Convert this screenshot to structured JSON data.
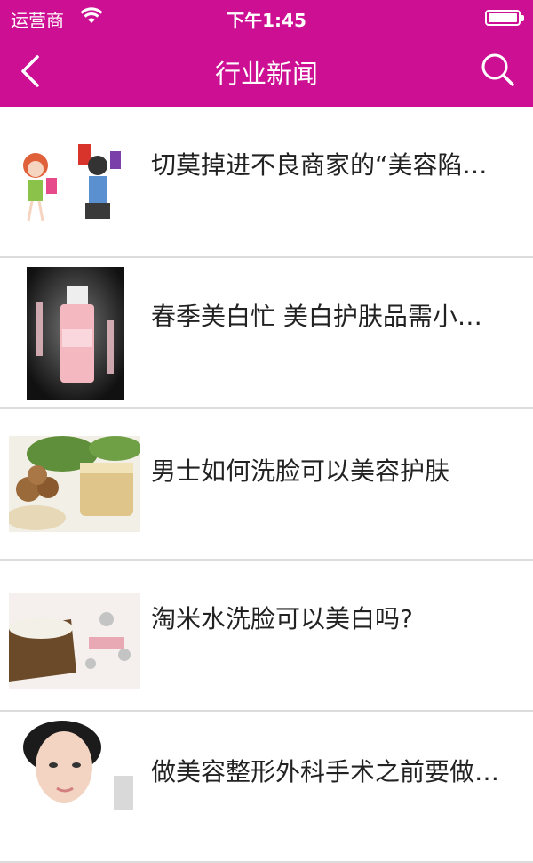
{
  "status_bar": {
    "carrier": "运营商",
    "time": "下午1:45"
  },
  "nav": {
    "title": "行业新闻",
    "back_icon": "chevron-left-icon",
    "search_icon": "search-icon"
  },
  "colors": {
    "brand": "#cc0f93",
    "text": "#222222",
    "divider": "#dcdcdc"
  },
  "news": [
    {
      "title": "切莫掉进不良商家的“美容陷…"
    },
    {
      "title": "春季美白忙 美白护肤品需小…"
    },
    {
      "title": "男士如何洗脸可以美容护肤"
    },
    {
      "title": "淘米水洗脸可以美白吗?"
    },
    {
      "title": "做美容整形外科手术之前要做…"
    }
  ]
}
